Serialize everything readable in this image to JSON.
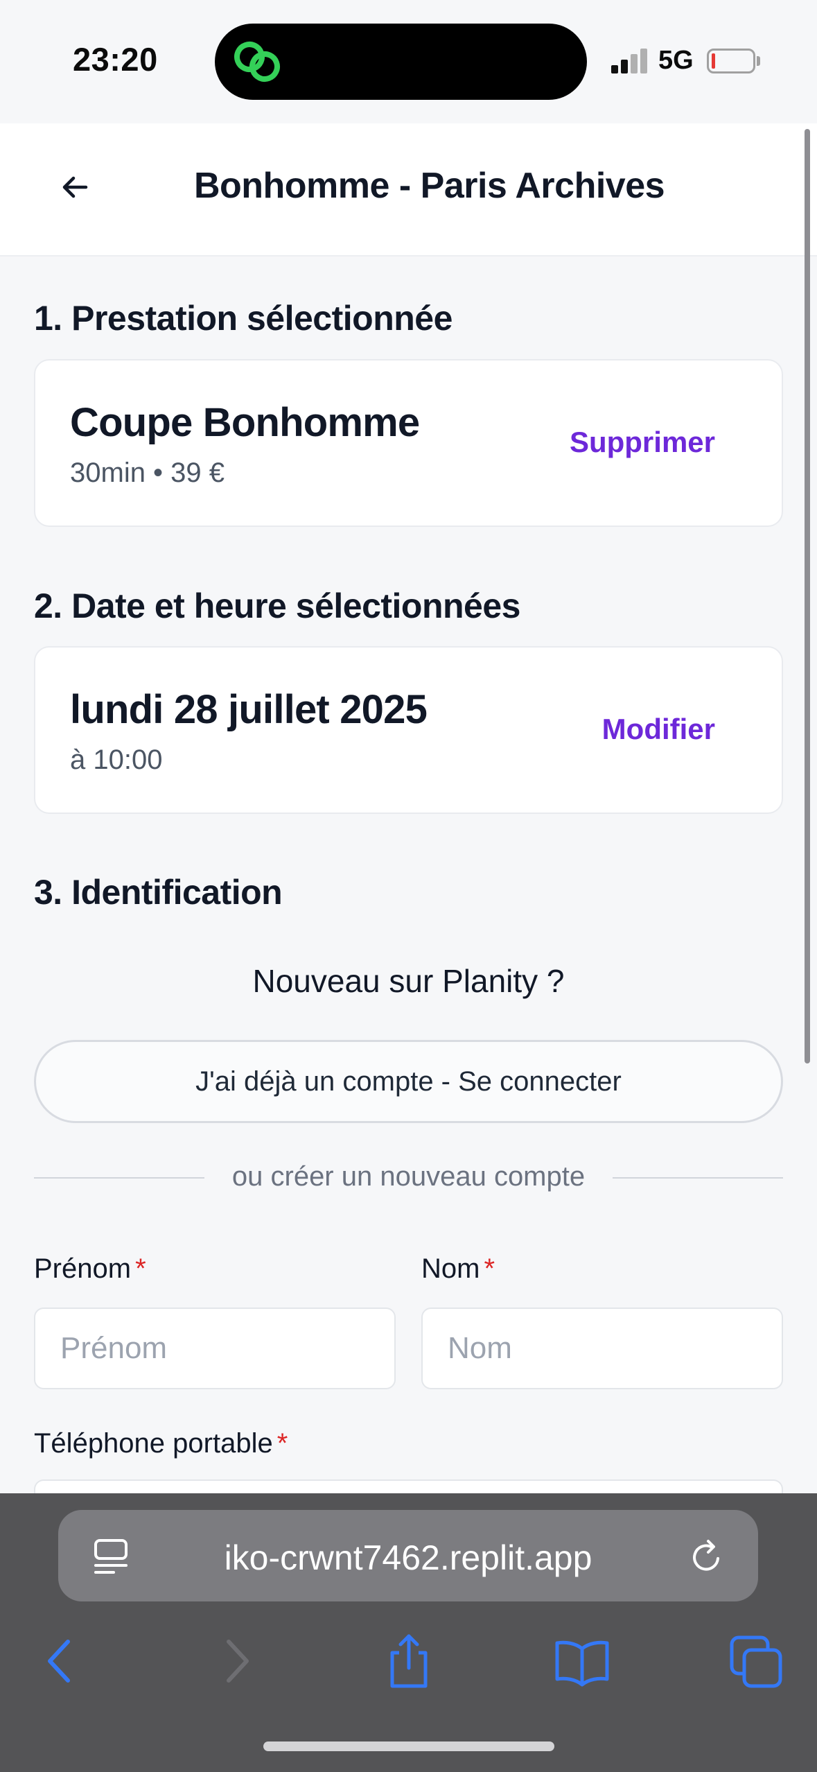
{
  "status_bar": {
    "time": "23:20",
    "network": "5G"
  },
  "header": {
    "title": "Bonhomme - Paris Archives"
  },
  "sections": {
    "service": {
      "heading": "1. Prestation sélectionnée",
      "name": "Coupe Bonhomme",
      "details": "30min • 39 €",
      "action": "Supprimer"
    },
    "datetime": {
      "heading": "2. Date et heure sélectionnées",
      "date": "lundi 28 juillet 2025",
      "time": "à 10:00",
      "action": "Modifier"
    },
    "identification": {
      "heading": "3. Identification",
      "prompt": "Nouveau sur Planity ?",
      "login_button": "J'ai déjà un compte - Se connecter",
      "divider": "ou créer un nouveau compte",
      "first_name_label": "Prénom",
      "first_name_placeholder": "Prénom",
      "last_name_label": "Nom",
      "last_name_placeholder": "Nom",
      "phone_label": "Téléphone portable",
      "required_mark": "*"
    }
  },
  "browser": {
    "url": "iko-crwnt7462.replit.app"
  },
  "colors": {
    "accent": "#6d28d9",
    "required": "#dc2626",
    "island_icon": "#34d058"
  }
}
